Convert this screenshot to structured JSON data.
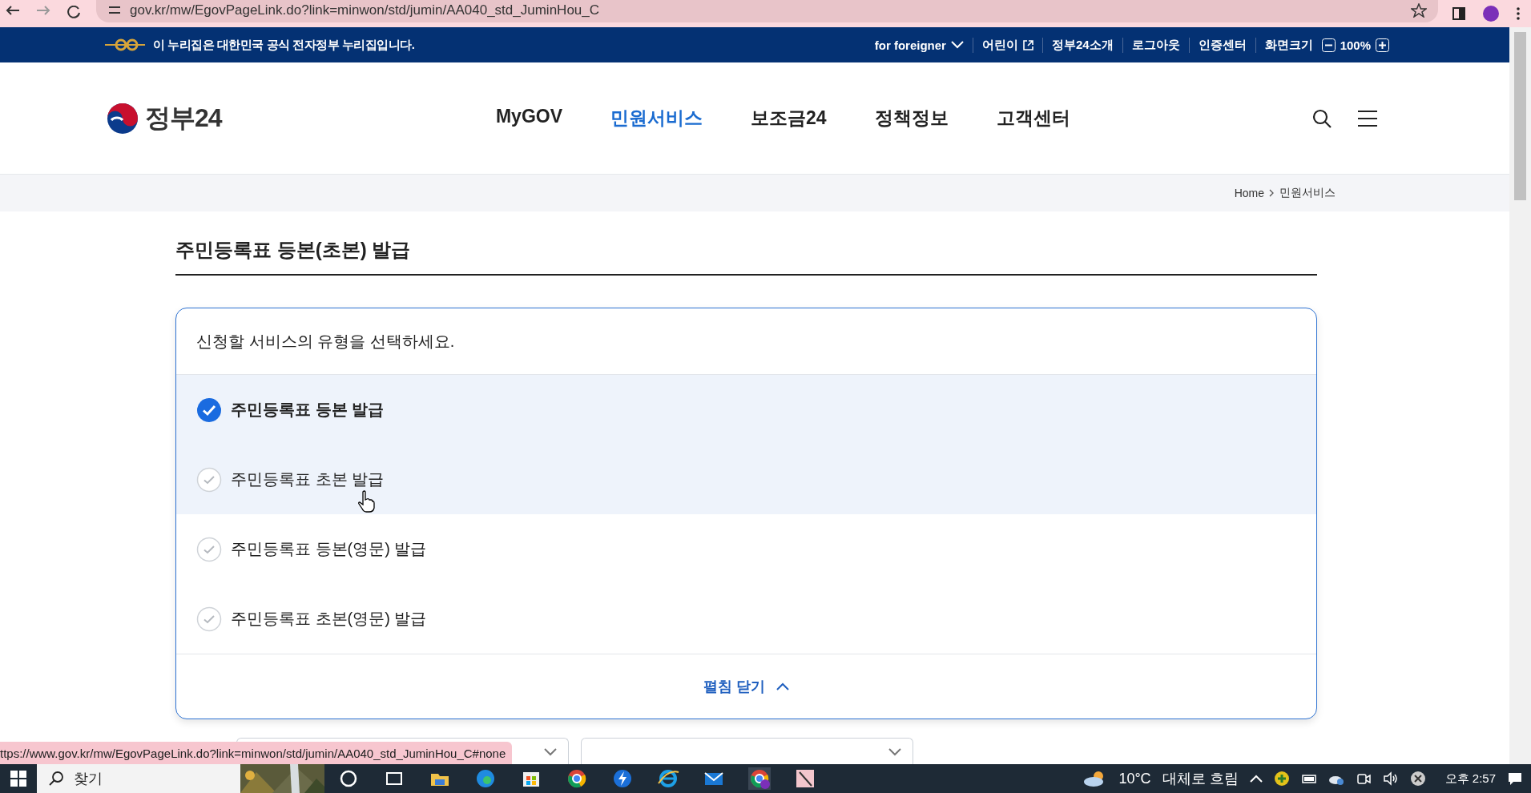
{
  "browser": {
    "url": "gov.kr/mw/EgovPageLink.do?link=minwon/std/jumin/AA040_std_JuminHou_C",
    "status_url": "ttps://www.gov.kr/mw/EgovPageLink.do?link=minwon/std/jumin/AA040_std_JuminHou_C#none"
  },
  "gov_banner": {
    "notice": "이 누리집은 대한민국 공식 전자정부 누리집입니다.",
    "links": [
      {
        "label": "for foreigner",
        "kind": "dropdown"
      },
      {
        "label": "어린이",
        "kind": "external"
      },
      {
        "label": "정부24소개",
        "kind": "plain"
      },
      {
        "label": "로그아웃",
        "kind": "plain"
      },
      {
        "label": "인증센터",
        "kind": "plain"
      }
    ],
    "zoom": {
      "label": "화면크기",
      "value": "100%"
    }
  },
  "header": {
    "logo": "정부24",
    "nav": [
      {
        "label": "MyGOV",
        "selected": false
      },
      {
        "label": "민원서비스",
        "selected": true
      },
      {
        "label": "보조금24",
        "selected": false
      },
      {
        "label": "정책정보",
        "selected": false
      },
      {
        "label": "고객센터",
        "selected": false
      }
    ]
  },
  "breadcrumb": [
    "Home",
    "민원서비스"
  ],
  "page_title": "주민등록표 등본(초본) 발급",
  "service_card": {
    "prompt": "신청할 서비스의 유형을 선택하세요.",
    "options": [
      {
        "label": "주민등록표 등본 발급",
        "selected": true,
        "hovered": false
      },
      {
        "label": "주민등록표 초본 발급",
        "selected": false,
        "hovered": true
      },
      {
        "label": "주민등록표 등본(영문) 발급",
        "selected": false,
        "hovered": false
      },
      {
        "label": "주민등록표 초본(영문) 발급",
        "selected": false,
        "hovered": false
      }
    ],
    "toggle": "펼침 닫기"
  },
  "taskbar": {
    "search_placeholder": "찾기",
    "weather": {
      "temperature": "10°C",
      "condition": "대체로 흐림"
    },
    "time": "오후 2:57"
  }
}
